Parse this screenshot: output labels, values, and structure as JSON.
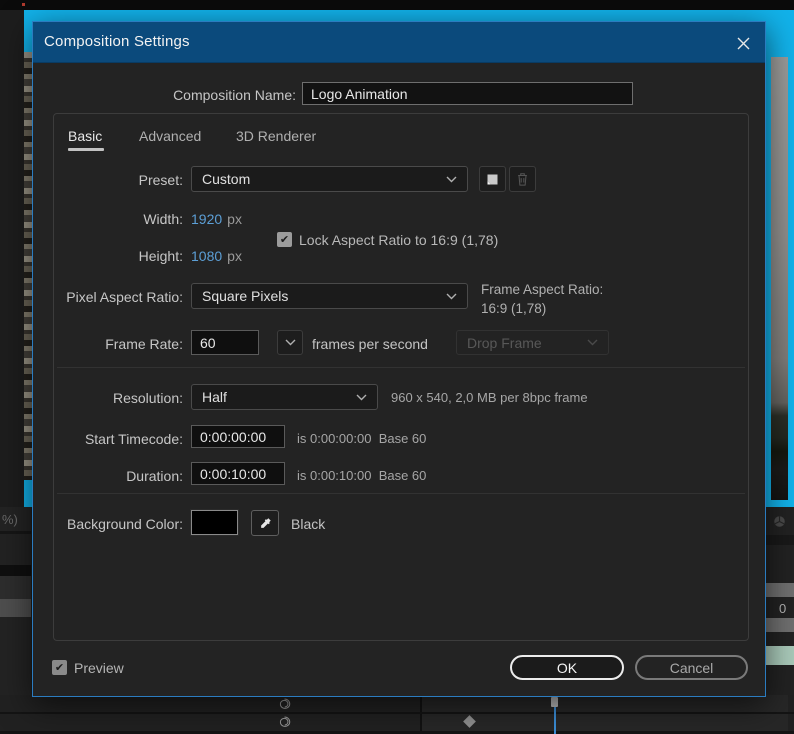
{
  "window": {
    "title": "Composition Settings"
  },
  "composition_name": {
    "label": "Composition Name:",
    "value": "Logo Animation"
  },
  "tabs": {
    "basic": "Basic",
    "advanced": "Advanced",
    "renderer": "3D Renderer"
  },
  "preset": {
    "label": "Preset:",
    "value": "Custom"
  },
  "dimensions": {
    "width_label": "Width:",
    "width_value": "1920",
    "width_unit": "px",
    "height_label": "Height:",
    "height_value": "1080",
    "height_unit": "px",
    "lock_label": "Lock Aspect Ratio to 16:9 (1,78)",
    "lock_checked": true
  },
  "pixel_aspect_ratio": {
    "label": "Pixel Aspect Ratio:",
    "value": "Square Pixels"
  },
  "frame_aspect_ratio": {
    "label": "Frame Aspect Ratio:",
    "value": "16:9 (1,78)"
  },
  "frame_rate": {
    "label": "Frame Rate:",
    "value": "60",
    "suffix": "frames per second",
    "timecode_style": "Drop Frame"
  },
  "resolution": {
    "label": "Resolution:",
    "value": "Half",
    "info": "960 x 540, 2,0 MB per 8bpc frame"
  },
  "start_timecode": {
    "label": "Start Timecode:",
    "value": "0:00:00:00",
    "info": "is 0:00:00:00",
    "base": "Base 60"
  },
  "duration": {
    "label": "Duration:",
    "value": "0:00:10:00",
    "info": "is 0:00:10:00",
    "base": "Base 60"
  },
  "background_color": {
    "label": "Background Color:",
    "name": "Black",
    "swatch": "#000000"
  },
  "footer": {
    "preview": "Preview",
    "ok": "OK",
    "cancel": "Cancel"
  },
  "icons": {
    "check": "✔"
  },
  "background_fragments": {
    "percent": "%)",
    "zero": "0"
  },
  "colors": {
    "titlebar_blue": "#0b4a7c",
    "accent_cyan": "#12b2ea",
    "value_blue": "#5c9fd6",
    "dialog_border": "#2b7cc0"
  }
}
